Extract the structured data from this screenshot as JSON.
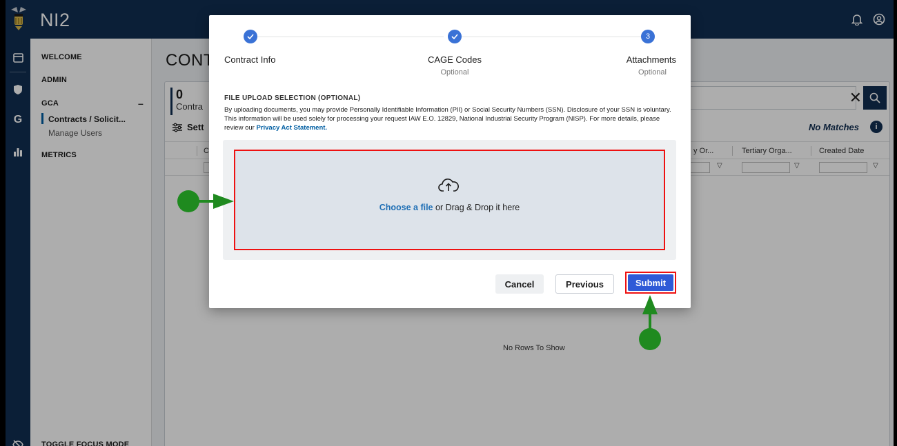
{
  "app": {
    "title": "NI2"
  },
  "sidebar": {
    "welcome": "WELCOME",
    "admin": "ADMIN",
    "gca": "GCA",
    "gca_toggle": "–",
    "contracts": "Contracts / Solicit...",
    "manage_users": "Manage Users",
    "metrics": "METRICS",
    "toggle_focus": "TOGGLE FOCUS MODE"
  },
  "page": {
    "title": "CONTR",
    "count": "0",
    "count_label": "Contra",
    "settings_label": "Sett",
    "no_matches": "No Matches",
    "info_badge": "i",
    "columns": [
      "C",
      "y Or...",
      "Tertiary Orga...",
      "Created Date"
    ],
    "no_rows": "No Rows To Show"
  },
  "modal": {
    "steps": [
      {
        "number": "✓",
        "label": "Contract Info",
        "optional": ""
      },
      {
        "number": "✓",
        "label": "CAGE Codes",
        "optional": "Optional"
      },
      {
        "number": "3",
        "label": "Attachments",
        "optional": "Optional"
      }
    ],
    "section_title": "FILE UPLOAD SELECTION (OPTIONAL)",
    "disclaimer": "By uploading documents, you may provide Personally Identifiable Information (PII) or Social Security Numbers (SSN). Disclosure of your SSN is voluntary. This information will be used solely for processing your request IAW E.O. 12829, National Industrial Security Program (NISP). For more details, please review our ",
    "privacy_link": "Privacy Act Statement.",
    "choose_file": "Choose a file",
    "drag_drop": " or Drag & Drop it here",
    "cancel": "Cancel",
    "previous": "Previous",
    "submit": "Submit"
  },
  "colors": {
    "navy": "#112e51",
    "step_blue": "#3a72d6",
    "submit_blue": "#2f5ad7",
    "highlight_red": "#e11111",
    "annotation_green": "#1f8a1f"
  },
  "icons": [
    "bell-icon",
    "user-circle-icon",
    "browser-window-icon",
    "shield-icon",
    "g-letter-icon",
    "bar-chart-icon",
    "eye-slash-icon",
    "sliders-icon",
    "search-icon",
    "close-icon",
    "filter-icon",
    "upload-cloud-icon",
    "checkmark-icon"
  ]
}
